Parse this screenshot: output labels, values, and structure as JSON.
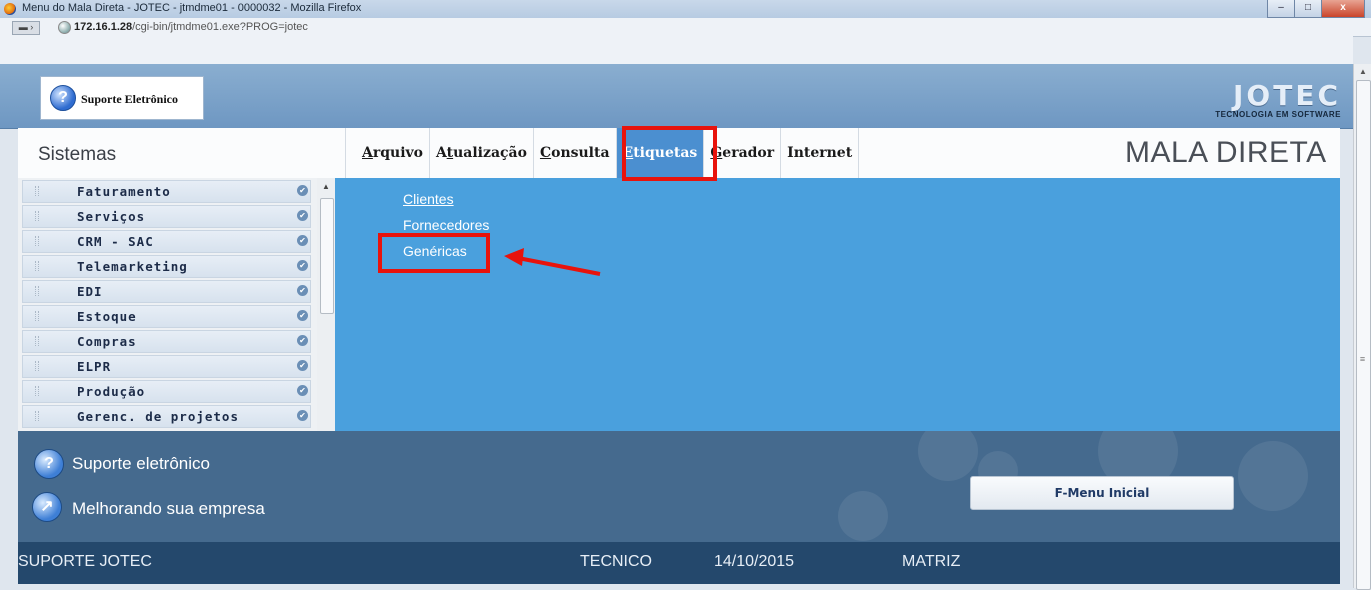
{
  "window": {
    "title": "Menu do Mala Direta - JOTEC - jtmdme01 - 0000032 - Mozilla Firefox",
    "minimize": "–",
    "maximize": "□",
    "close": "x"
  },
  "address": {
    "host": "172.16.1.28",
    "path": "/cgi-bin/jtmdme01.exe?PROG=jotec"
  },
  "header": {
    "support_label": "Suporte Eletrônico",
    "logo_name": "JOTEC",
    "logo_tagline": "TECNOLOGIA EM SOFTWARE"
  },
  "sidebar": {
    "title": "Sistemas",
    "items": [
      {
        "label": "Faturamento"
      },
      {
        "label": "Serviços"
      },
      {
        "label": "CRM - SAC"
      },
      {
        "label": "Telemarketing"
      },
      {
        "label": "EDI"
      },
      {
        "label": "Estoque"
      },
      {
        "label": "Compras"
      },
      {
        "label": "ELPR"
      },
      {
        "label": "Produção"
      },
      {
        "label": "Gerenc. de projetos"
      }
    ]
  },
  "menu": {
    "items": [
      {
        "key": "A",
        "rest": "rquivo"
      },
      {
        "pre": "A",
        "key": "t",
        "rest": "ualização"
      },
      {
        "key": "C",
        "rest": "onsulta"
      },
      {
        "key": "E",
        "rest": "tiquetas"
      },
      {
        "key": "G",
        "rest": "erador"
      },
      {
        "label": "Internet"
      }
    ],
    "active_index": 3,
    "module_title": "MALA DIRETA"
  },
  "dropdown": {
    "items": [
      "Clientes",
      "Fornecedores",
      "Genéricas"
    ]
  },
  "footer": {
    "support_line": "Suporte eletrônico",
    "improve_line": "Melhorando sua empresa",
    "fmenu_button": "F-Menu Inicial"
  },
  "status": {
    "left": "SUPORTE JOTEC",
    "user": "TECNICO",
    "date": "14/10/2015",
    "branch": "MATRIZ"
  },
  "colors": {
    "content_blue": "#4aa0dd",
    "highlight_red": "#e8130c",
    "status_bar": "#24486c"
  }
}
